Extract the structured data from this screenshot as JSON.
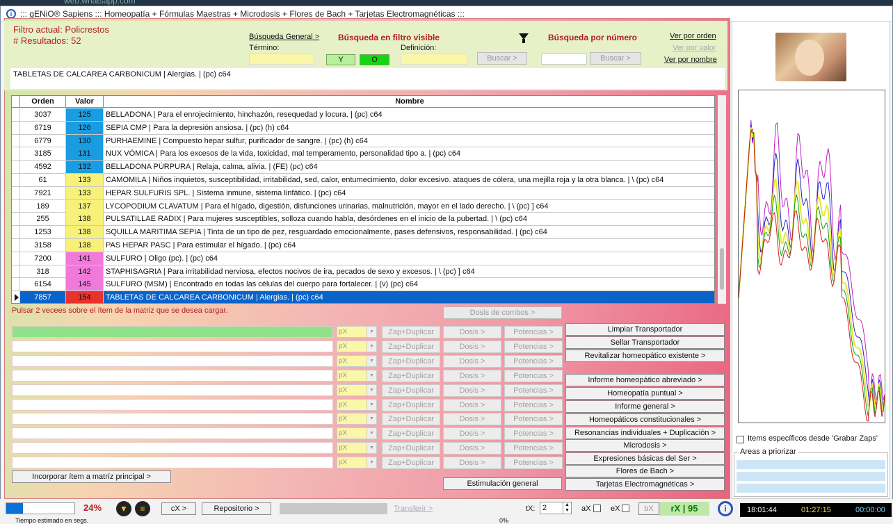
{
  "background": {
    "text": "web.whatsapp.com"
  },
  "title": "::: gENiO® Sapiens ::: Homeopatía + Fórmulas Maestras + Microdosis + Flores de Bach + Tarjetas Electromagnéticas :::",
  "header": {
    "filter_line": "Filtro actual: Policrestos",
    "results_line": "# Resultados: 52",
    "busqueda_general": "Búsqueda General >",
    "termino": "Término:",
    "busqueda_filtro": "Búsqueda en filtro visible",
    "definicion": "Definición:",
    "btn_y": "Y",
    "btn_o": "O",
    "buscar1": "Buscar >",
    "busqueda_numero": "Búsqueda por número",
    "buscar2": "Buscar >",
    "ver_orden": "Ver por orden",
    "ver_valor": "Ver por valor",
    "ver_nombre": "Ver por nombre"
  },
  "selected_text": "TABLETAS DE CALCAREA CARBONICUM | Alergias. | (pc) c64",
  "grid": {
    "columns": [
      "Orden",
      "Valor",
      "Nombre"
    ],
    "rows": [
      {
        "orden": "3037",
        "valor": "125",
        "color": "#1a9ce0",
        "nombre": "BELLADONA | Para el enrojecimiento, hinchazón, resequedad y locura. | (pc) c64"
      },
      {
        "orden": "6719",
        "valor": "126",
        "color": "#1a9ce0",
        "nombre": "SEPIA CMP | Para la depresión ansiosa. | (pc) (h) c64"
      },
      {
        "orden": "6779",
        "valor": "130",
        "color": "#1a9ce0",
        "nombre": "PURHAEMINE | Compuesto hepar sulfur, purificador de sangre. | (pc) (h) c64"
      },
      {
        "orden": "3185",
        "valor": "131",
        "color": "#1a9ce0",
        "nombre": "NUX VÓMICA | Para los excesos de la vida, toxicidad, mal temperamento, personalidad tipo a. | (pc) c64"
      },
      {
        "orden": "4592",
        "valor": "132",
        "color": "#1a9ce0",
        "nombre": "BELLADONA PÚRPURA | Relaja, calma, alivia. | (FE) (pc) c64"
      },
      {
        "orden": "61",
        "valor": "133",
        "color": "#f7f07a",
        "nombre": "CAMOMILA | Niños inquietos, susceptibilidad, irritabilidad, sed, calor, entumecimiento, dolor excesivo. ataques de cólera, una mejilla roja y la otra blanca. | \\ (pc) c64"
      },
      {
        "orden": "7921",
        "valor": "133",
        "color": "#f7f07a",
        "nombre": "HEPAR SULFURIS SPL. | Sistema inmune, sistema linfático. | (pc) c64"
      },
      {
        "orden": "189",
        "valor": "137",
        "color": "#f7f07a",
        "nombre": "LYCOPODIUM CLAVATUM | Para el hígado, digestión, disfunciones urinarias, malnutrición, mayor en el lado derecho. | \\ (pc) ] c64"
      },
      {
        "orden": "255",
        "valor": "138",
        "color": "#f7f07a",
        "nombre": "PULSATILLAE RADIX | Para mujeres susceptibles, solloza cuando habla, desórdenes en el inicio de la pubertad. | \\ (pc) c64"
      },
      {
        "orden": "1253",
        "valor": "138",
        "color": "#f7f07a",
        "nombre": "SQUILLA MARITIMA SEPIA | Tinta de un tipo de pez, resguardado emocionalmente, pases defensivos, responsabilidad. | (pc) c64"
      },
      {
        "orden": "3158",
        "valor": "138",
        "color": "#f7f07a",
        "nombre": "PAS HEPAR PASC | Para estimular el hígado. | (pc) c64"
      },
      {
        "orden": "7200",
        "valor": "141",
        "color": "#f07ad9",
        "nombre": "SULFURO | Oligo (pc). | (pc) c64"
      },
      {
        "orden": "318",
        "valor": "142",
        "color": "#f07ad9",
        "nombre": "STAPHISAGRIA | Para irritabilidad nerviosa, efectos nocivos de ira, pecados de sexo y excesos. | \\ (pc) ] c64"
      },
      {
        "orden": "6154",
        "valor": "145",
        "color": "#f07ad9",
        "nombre": "SULFURO (MSM) | Encontrado en todas las células del cuerpo para fortalecer. | (v) (pc) c64"
      },
      {
        "orden": "7857",
        "valor": "154",
        "color": "#e8322e",
        "nombre": "TABLETAS DE CALCAREA CARBONICUM | Alergias. | (pc) c64",
        "active": true
      }
    ]
  },
  "hint": "Pulsar 2 vecees sobre el ítem de la matriz que se desea cargar.",
  "transport": {
    "dosis_combos": "Dosis de combos >",
    "px": "pX",
    "zap": "Zap+Duplicar",
    "dosis": "Dosis >",
    "potencias": "Potencias >",
    "incorporar": "Incorporar ítem a matríz principal >",
    "estimulacion": "Estimulación general"
  },
  "right_buttons": [
    "Limpiar Transportador",
    "Sellar Transportador",
    "Revitalizar homeopático existente >",
    "Informe homeopático abreviado >",
    "Homeopatía puntual >",
    "Informe general >",
    "Homeopáticos constitucionales >",
    "Resonancias individuales + Duplicación >",
    "Microdosis >",
    "Expresiones básicas del Ser >",
    "Flores de Bach >",
    "Tarjetas Electromagnéticas >"
  ],
  "side": {
    "items_especificos": "Items específicos desde 'Grabar Zaps'",
    "areas_priorizar": "Areas a priorizar"
  },
  "status": {
    "progress": 0.24,
    "percent": "24%",
    "cx": "cX >",
    "repositorio": "Repositorio >",
    "transferir": "Transferir >",
    "tx_label": "tX:",
    "tx_value": "2",
    "ax": "aX",
    "ex": "eX",
    "bx": "bX",
    "rx": "rX | 95",
    "tiempo": "Tiempo estimado en segs.",
    "zero_pct": "0%",
    "clock1": "18:01:44",
    "clock2": "01:27:15",
    "clock3": "00:00:00"
  },
  "colors": {
    "accent_blue": "#0a63c9",
    "red_text": "#b31c1c",
    "green_btn": "#14d614"
  }
}
